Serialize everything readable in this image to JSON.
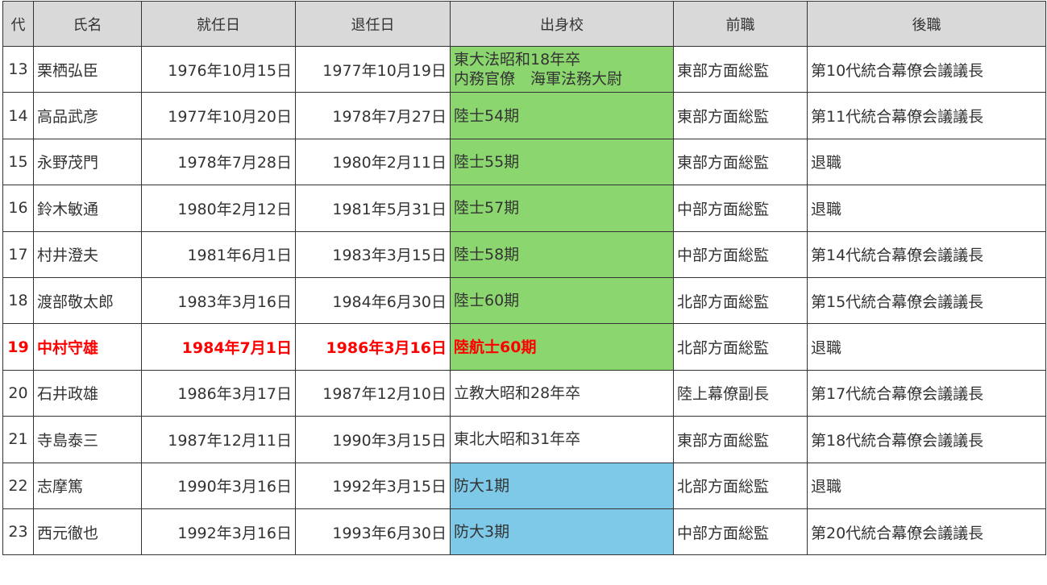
{
  "headers": {
    "dai": "代",
    "name": "氏名",
    "start": "就任日",
    "end": "退任日",
    "school": "出身校",
    "prev": "前職",
    "next": "後職"
  },
  "colors": {
    "army_school": "#8cd66f",
    "defense_academy": "#7ec8e8",
    "highlight_text": "#ff0000",
    "header_bg": "#d9d9d9"
  },
  "rows": [
    {
      "dai": "13",
      "name": "栗栖弘臣",
      "start": "1976年10月15日",
      "end": "1977年10月19日",
      "school": [
        "東大法昭和18年卒",
        "内務官僚　海軍法務大尉"
      ],
      "school_group": "army",
      "prev": "東部方面総監",
      "next": "第10代統合幕僚会議議長"
    },
    {
      "dai": "14",
      "name": "高品武彦",
      "start": "1977年10月20日",
      "end": "1978年7月27日",
      "school": [
        "陸士54期"
      ],
      "school_group": "army",
      "prev": "東部方面総監",
      "next": "第11代統合幕僚会議議長"
    },
    {
      "dai": "15",
      "name": "永野茂門",
      "start": "1978年7月28日",
      "end": "1980年2月11日",
      "school": [
        "陸士55期"
      ],
      "school_group": "army",
      "prev": "東部方面総監",
      "next": "退職"
    },
    {
      "dai": "16",
      "name": "鈴木敏通",
      "start": "1980年2月12日",
      "end": "1981年5月31日",
      "school": [
        "陸士57期"
      ],
      "school_group": "army",
      "prev": "中部方面総監",
      "next": "退職"
    },
    {
      "dai": "17",
      "name": "村井澄夫",
      "start": "1981年6月1日",
      "end": "1983年3月15日",
      "school": [
        "陸士58期"
      ],
      "school_group": "army",
      "prev": "中部方面総監",
      "next": "第14代統合幕僚会議議長"
    },
    {
      "dai": "18",
      "name": "渡部敬太郎",
      "start": "1983年3月16日",
      "end": "1984年6月30日",
      "school": [
        "陸士60期"
      ],
      "school_group": "army",
      "prev": "北部方面総監",
      "next": "第15代統合幕僚会議議長"
    },
    {
      "dai": "19",
      "name": "中村守雄",
      "start": "1984年7月1日",
      "end": "1986年3月16日",
      "school": [
        "陸航士60期"
      ],
      "school_group": "army",
      "prev": "北部方面総監",
      "next": "退職",
      "highlight": true
    },
    {
      "dai": "20",
      "name": "石井政雄",
      "start": "1986年3月17日",
      "end": "1987年12月10日",
      "school": [
        "立教大昭和28年卒"
      ],
      "school_group": "none",
      "prev": "陸上幕僚副長",
      "next": "第17代統合幕僚会議議長"
    },
    {
      "dai": "21",
      "name": "寺島泰三",
      "start": "1987年12月11日",
      "end": "1990年3月15日",
      "school": [
        "東北大昭和31年卒"
      ],
      "school_group": "none",
      "prev": "東部方面総監",
      "next": "第18代統合幕僚会議議長"
    },
    {
      "dai": "22",
      "name": "志摩篤",
      "start": "1990年3月16日",
      "end": "1992年3月15日",
      "school": [
        "防大1期"
      ],
      "school_group": "nda",
      "prev": "北部方面総監",
      "next": "退職"
    },
    {
      "dai": "23",
      "name": "西元徹也",
      "start": "1992年3月16日",
      "end": "1993年6月30日",
      "school": [
        "防大3期"
      ],
      "school_group": "nda",
      "prev": "中部方面総監",
      "next": "第20代統合幕僚会議議長"
    }
  ]
}
